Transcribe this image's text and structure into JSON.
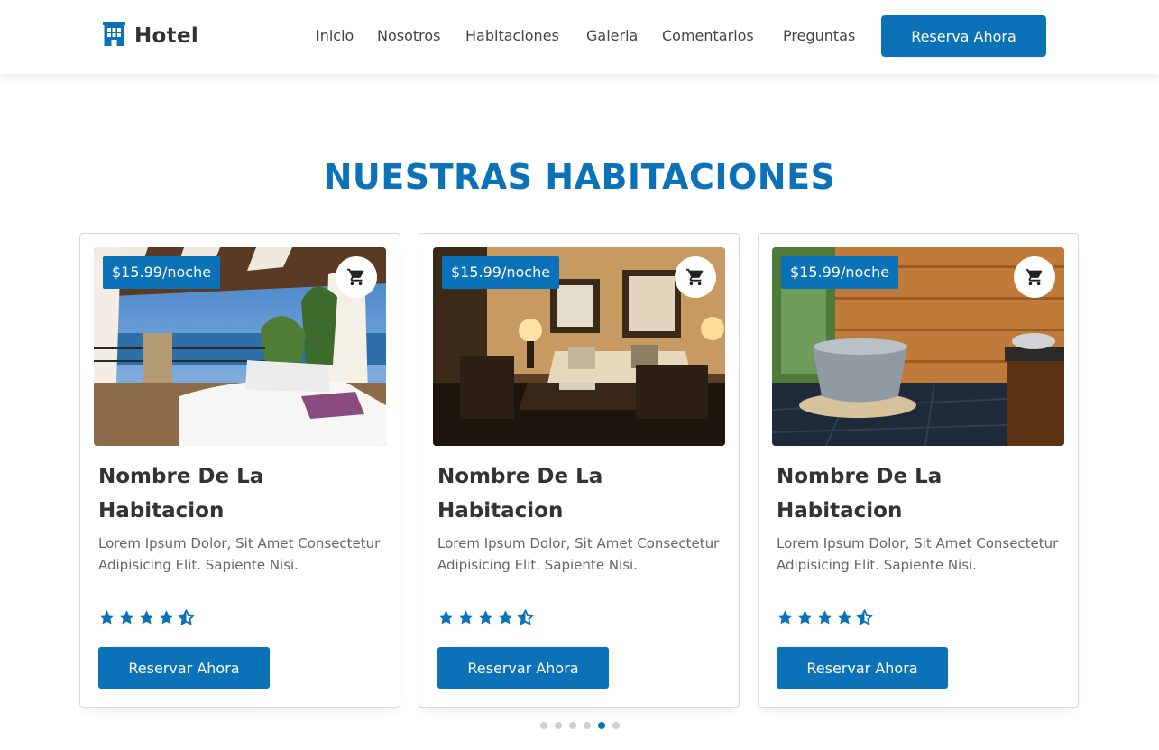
{
  "header": {
    "brand": "Hotel",
    "nav": [
      "Inicio",
      "Nosotros",
      "Habitaciones",
      "Galeria",
      "Comentarios",
      "Preguntas"
    ],
    "cta_label": "Reserva Ahora",
    "accent_color": "#0b72b8",
    "logo_icon": "building-icon"
  },
  "section": {
    "title": "NUESTRAS HABITACIONES"
  },
  "rooms": [
    {
      "price": "$15.99/noche",
      "title": "Nombre De La Habitacion",
      "description": "Lorem Ipsum Dolor, Sit Amet Consectetur Adipisicing Elit. Sapiente Nisi.",
      "rating": 4.5,
      "button": "Reservar Ahora",
      "image": "seaside-canopy-bed-photo"
    },
    {
      "price": "$15.99/noche",
      "title": "Nombre De La Habitacion",
      "description": "Lorem Ipsum Dolor, Sit Amet Consectetur Adipisicing Elit. Sapiente Nisi.",
      "rating": 4.5,
      "button": "Reservar Ahora",
      "image": "living-room-photo"
    },
    {
      "price": "$15.99/noche",
      "title": "Nombre De La Habitacion",
      "description": "Lorem Ipsum Dolor, Sit Amet Consectetur Adipisicing Elit. Sapiente Nisi.",
      "rating": 4.5,
      "button": "Reservar Ahora",
      "image": "stone-bathtub-photo"
    }
  ],
  "carousel": {
    "dot_count": 6,
    "active_index": 4
  }
}
